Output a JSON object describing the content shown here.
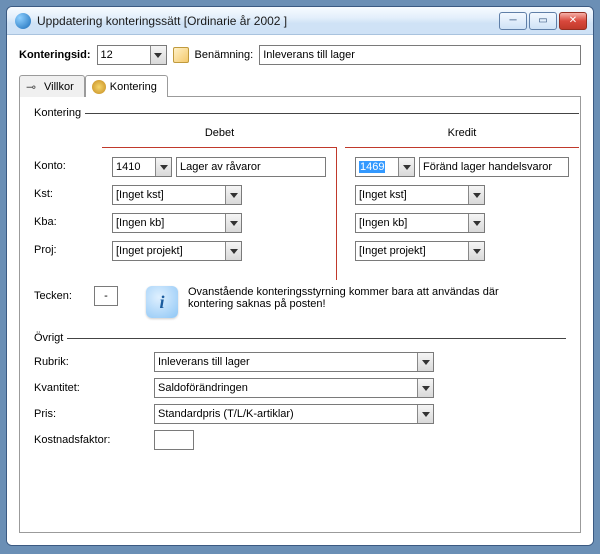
{
  "window": {
    "title": "Uppdatering konteringssätt [Ordinarie år 2002 ]"
  },
  "top": {
    "konteringsid_label": "Konteringsid:",
    "konteringsid_value": "12",
    "benamnning_label": "Benämning:",
    "benamnning_value": "Inleverans till lager"
  },
  "tabs": {
    "villkor": "Villkor",
    "kontering": "Kontering"
  },
  "kontering": {
    "legend": "Kontering",
    "debet_header": "Debet",
    "kredit_header": "Kredit",
    "labels": {
      "konto": "Konto:",
      "kst": "Kst:",
      "kba": "Kba:",
      "proj": "Proj:",
      "tecken": "Tecken:"
    },
    "debet": {
      "konto_code": "1410",
      "konto_name": "Lager av råvaror",
      "kst": "[Inget kst]",
      "kba": "[Ingen kb]",
      "proj": "[Inget projekt]"
    },
    "kredit": {
      "konto_code": "1469",
      "konto_name": "Föränd lager handelsvaror",
      "kst": "[Inget kst]",
      "kba": "[Ingen kb]",
      "proj": "[Inget projekt]"
    },
    "tecken_value": "-",
    "info_text": "Ovanstående konteringsstyrning kommer bara att användas där kontering saknas på posten!"
  },
  "ovrigt": {
    "legend": "Övrigt",
    "rubrik_label": "Rubrik:",
    "rubrik_value": "Inleverans till lager",
    "kvantitet_label": "Kvantitet:",
    "kvantitet_value": "Saldoförändringen",
    "pris_label": "Pris:",
    "pris_value": "Standardpris (T/L/K-artiklar)",
    "kostnadsfaktor_label": "Kostnadsfaktor:",
    "kostnadsfaktor_value": ""
  }
}
